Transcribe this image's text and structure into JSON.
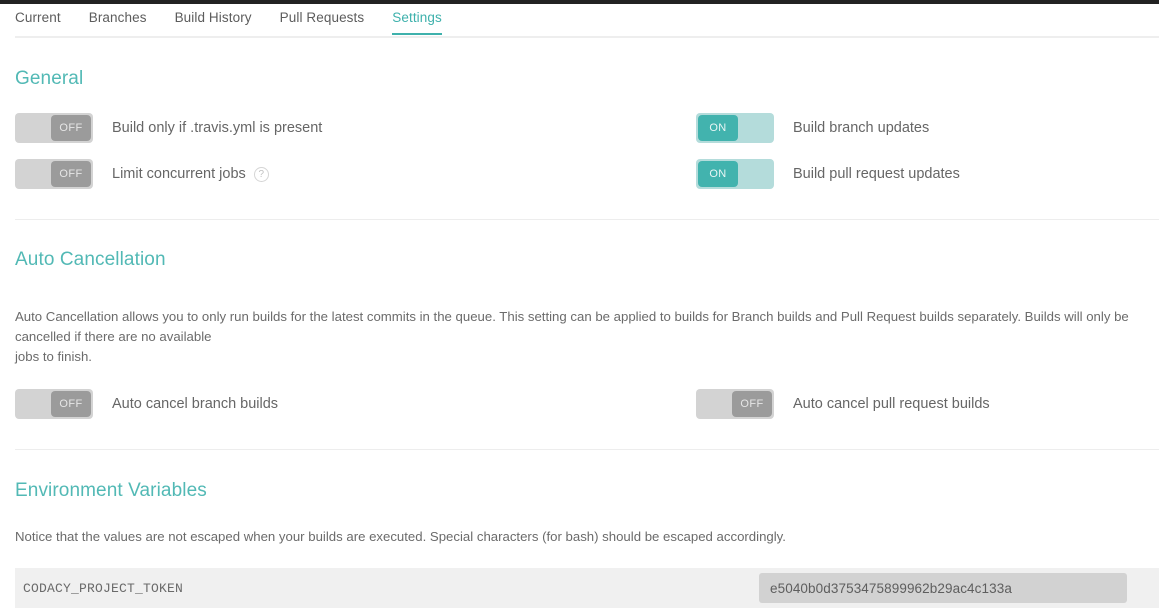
{
  "tabs": [
    {
      "label": "Current",
      "active": false
    },
    {
      "label": "Branches",
      "active": false
    },
    {
      "label": "Build History",
      "active": false
    },
    {
      "label": "Pull Requests",
      "active": false
    },
    {
      "label": "Settings",
      "active": true
    }
  ],
  "colors": {
    "accent_teal": "#3eb1ac",
    "heading_teal": "#52b9b5",
    "toggle_on_track": "#b4dcdb",
    "toggle_on_knob": "#42b3ae",
    "toggle_off_track": "#d3d3d3",
    "toggle_off_knob": "#9b9b9b",
    "row_background": "#f0f0f0",
    "value_pill": "#d2d2d2"
  },
  "general": {
    "title": "General",
    "settings": [
      {
        "state_label": "OFF",
        "state": "off",
        "label": "Build only if .travis.yml is present",
        "help": false
      },
      {
        "state_label": "ON",
        "state": "on",
        "label": "Build branch updates",
        "help": false
      },
      {
        "state_label": "OFF",
        "state": "off",
        "label": "Limit concurrent jobs",
        "help": true,
        "help_icon": "question-mark-icon",
        "help_glyph": "?"
      },
      {
        "state_label": "ON",
        "state": "on",
        "label": "Build pull request updates",
        "help": false
      }
    ]
  },
  "auto_cancellation": {
    "title": "Auto Cancellation",
    "description": "Auto Cancellation allows you to only run builds for the latest commits in the queue. This setting can be applied to builds for Branch builds and Pull Request builds separately. Builds will only be cancelled if there are no available\njobs to finish.",
    "settings": [
      {
        "state_label": "OFF",
        "state": "off",
        "label": "Auto cancel branch builds",
        "help": false
      },
      {
        "state_label": "OFF",
        "state": "off",
        "label": "Auto cancel pull request builds",
        "help": false
      }
    ]
  },
  "environment_variables": {
    "title": "Environment Variables",
    "description": "Notice that the values are not escaped when your builds are executed. Special characters (for bash) should be escaped accordingly.",
    "rows": [
      {
        "name": "CODACY_PROJECT_TOKEN",
        "value": "e5040b0d3753475899962b29ac4c133a"
      }
    ]
  }
}
